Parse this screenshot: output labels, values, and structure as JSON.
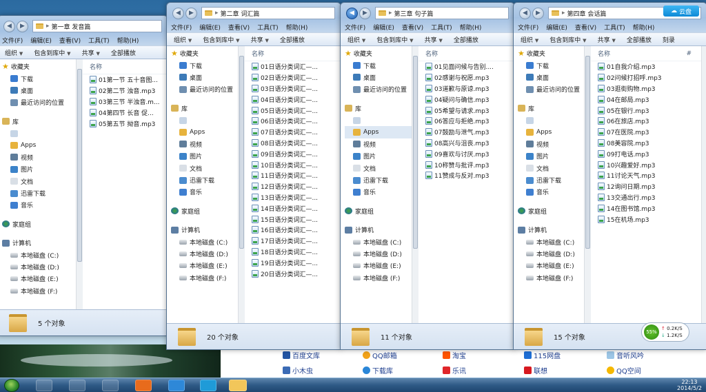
{
  "menu": [
    "文件(F)",
    "编辑(E)",
    "查看(V)",
    "工具(T)",
    "帮助(H)"
  ],
  "toolbar": [
    "组织",
    "包含到库中",
    "共享",
    "全部播放",
    "刻录"
  ],
  "sidebar": {
    "favorites": "收藏夹",
    "fav_items": [
      "下载",
      "桌面",
      "最近访问的位置"
    ],
    "library": "库",
    "lib_items": [
      "Apps",
      "视频",
      "图片",
      "文档",
      "迅雷下载",
      "音乐"
    ],
    "homegroup": "家庭组",
    "computer": "计算机",
    "drives": [
      "本地磁盘 (C:)",
      "本地磁盘 (D:)",
      "本地磁盘 (E:)",
      "本地磁盘 (F:)"
    ]
  },
  "column_name": "名称",
  "column_hash": "#",
  "windows": [
    {
      "path": "第一章 发音篇",
      "count": "5 个对象",
      "files": [
        "01第一节 五十音图...",
        "02第二节 浊音.mp3",
        "03第三节 半浊音.m...",
        "04第四节 长音 促...",
        "05第五节 拗音.mp3"
      ]
    },
    {
      "path": "第二章 词汇篇",
      "count": "20 个对象",
      "files": [
        "01日语分类词汇—...",
        "02日语分类词汇—...",
        "03日语分类词汇—...",
        "04日语分类词汇—...",
        "05日语分类词汇—...",
        "06日语分类词汇—...",
        "07日语分类词汇—...",
        "08日语分类词汇—...",
        "09日语分类词汇—...",
        "10日语分类词汇—...",
        "11日语分类词汇—...",
        "12日语分类词汇—...",
        "13日语分类词汇—...",
        "14日语分类词汇—...",
        "15日语分类词汇—...",
        "16日语分类词汇—...",
        "17日语分类词汇—...",
        "18日语分类词汇—...",
        "19日语分类词汇—...",
        "20日语分类词汇—..."
      ]
    },
    {
      "path": "第三章 句子篇",
      "count": "11 个对象",
      "files": [
        "01见面问候与告别....",
        "02感谢与祝愿.mp3",
        "03道歉与原谅.mp3",
        "04疑问与确信.mp3",
        "05希望与请求.mp3",
        "06答应与拒绝.mp3",
        "07鼓励与泄气.mp3",
        "08高兴与沮丧.mp3",
        "09喜欢与讨厌.mp3",
        "10称赞与批评.mp3",
        "11赞成与反对.mp3"
      ]
    },
    {
      "path": "第四章 会话篇",
      "count": "15 个对象",
      "files": [
        "01自我介绍.mp3",
        "02问候打招呼.mp3",
        "03逛街购物.mp3",
        "04在邮局.mp3",
        "05在银行.mp3",
        "06在旅店.mp3",
        "07在医院.mp3",
        "08美容院.mp3",
        "09打电话.mp3",
        "10兴趣爱好.mp3",
        "11讨论天气.mp3",
        "12询问日期.mp3",
        "13交通出行.mp3",
        "14在图书馆.mp3",
        "15在机场.mp3"
      ]
    }
  ],
  "cloud_label": "云盘",
  "net": {
    "percent": "55%",
    "up": "0.2K/S",
    "down": "1.2K/S"
  },
  "bookmarks": [
    "百度文库",
    "QQ邮箱",
    "淘宝",
    "115网盘",
    "音听风吟",
    "小木虫",
    "下载库",
    "乐讯",
    "联想",
    "QQ空间"
  ],
  "clock": {
    "time": "22:13",
    "date": "2014/5/2"
  }
}
